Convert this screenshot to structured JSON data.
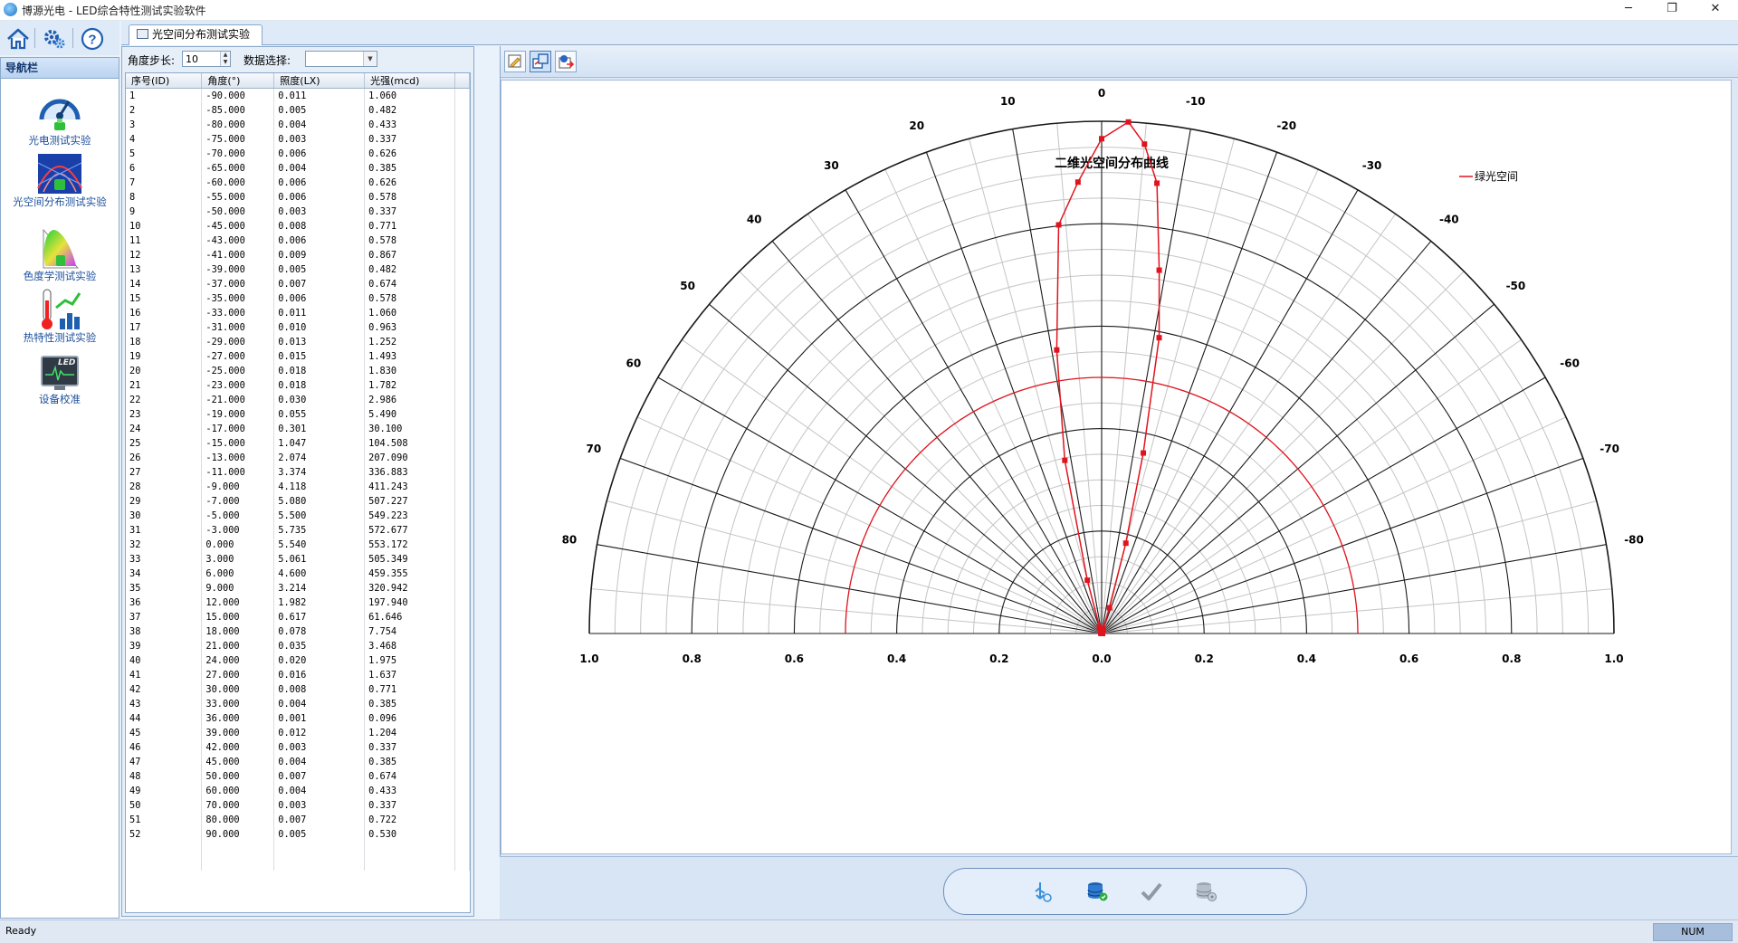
{
  "window": {
    "title": "博源光电 - LED综合特性测试实验软件",
    "minimize": "─",
    "restore": "❐",
    "close": "✕"
  },
  "toolbar": {
    "home_icon": "home-icon",
    "settings_icon": "gear-icon",
    "help_icon": "help-icon"
  },
  "nav": {
    "header": "导航栏",
    "items": [
      {
        "label": "光电测试实验",
        "icon": "gauge-icon"
      },
      {
        "label": "光空间分布测试实验",
        "icon": "spatial-distribution-icon"
      },
      {
        "label": "色度学测试实验",
        "icon": "chromaticity-icon"
      },
      {
        "label": "热特性测试实验",
        "icon": "thermometer-icon"
      },
      {
        "label": "设备校准",
        "icon": "calibration-monitor-icon"
      }
    ]
  },
  "tab": {
    "label": "光空间分布测试实验"
  },
  "controls": {
    "step_label": "角度步长:",
    "step_value": "10",
    "data_label": "数据选择:",
    "data_value": ""
  },
  "table": {
    "columns": [
      "序号(ID)",
      "角度(°)",
      "照度(LX)",
      "光强(mcd)"
    ],
    "rows": [
      [
        "1",
        "-90.000",
        "0.011",
        "1.060"
      ],
      [
        "2",
        "-85.000",
        "0.005",
        "0.482"
      ],
      [
        "3",
        "-80.000",
        "0.004",
        "0.433"
      ],
      [
        "4",
        "-75.000",
        "0.003",
        "0.337"
      ],
      [
        "5",
        "-70.000",
        "0.006",
        "0.626"
      ],
      [
        "6",
        "-65.000",
        "0.004",
        "0.385"
      ],
      [
        "7",
        "-60.000",
        "0.006",
        "0.626"
      ],
      [
        "8",
        "-55.000",
        "0.006",
        "0.578"
      ],
      [
        "9",
        "-50.000",
        "0.003",
        "0.337"
      ],
      [
        "10",
        "-45.000",
        "0.008",
        "0.771"
      ],
      [
        "11",
        "-43.000",
        "0.006",
        "0.578"
      ],
      [
        "12",
        "-41.000",
        "0.009",
        "0.867"
      ],
      [
        "13",
        "-39.000",
        "0.005",
        "0.482"
      ],
      [
        "14",
        "-37.000",
        "0.007",
        "0.674"
      ],
      [
        "15",
        "-35.000",
        "0.006",
        "0.578"
      ],
      [
        "16",
        "-33.000",
        "0.011",
        "1.060"
      ],
      [
        "17",
        "-31.000",
        "0.010",
        "0.963"
      ],
      [
        "18",
        "-29.000",
        "0.013",
        "1.252"
      ],
      [
        "19",
        "-27.000",
        "0.015",
        "1.493"
      ],
      [
        "20",
        "-25.000",
        "0.018",
        "1.830"
      ],
      [
        "21",
        "-23.000",
        "0.018",
        "1.782"
      ],
      [
        "22",
        "-21.000",
        "0.030",
        "2.986"
      ],
      [
        "23",
        "-19.000",
        "0.055",
        "5.490"
      ],
      [
        "24",
        "-17.000",
        "0.301",
        "30.100"
      ],
      [
        "25",
        "-15.000",
        "1.047",
        "104.508"
      ],
      [
        "26",
        "-13.000",
        "2.074",
        "207.090"
      ],
      [
        "27",
        "-11.000",
        "3.374",
        "336.883"
      ],
      [
        "28",
        "-9.000",
        "4.118",
        "411.243"
      ],
      [
        "29",
        "-7.000",
        "5.080",
        "507.227"
      ],
      [
        "30",
        "-5.000",
        "5.500",
        "549.223"
      ],
      [
        "31",
        "-3.000",
        "5.735",
        "572.677"
      ],
      [
        "32",
        "0.000",
        "5.540",
        "553.172"
      ],
      [
        "33",
        "3.000",
        "5.061",
        "505.349"
      ],
      [
        "34",
        "6.000",
        "4.600",
        "459.355"
      ],
      [
        "35",
        "9.000",
        "3.214",
        "320.942"
      ],
      [
        "36",
        "12.000",
        "1.982",
        "197.940"
      ],
      [
        "37",
        "15.000",
        "0.617",
        "61.646"
      ],
      [
        "38",
        "18.000",
        "0.078",
        "7.754"
      ],
      [
        "39",
        "21.000",
        "0.035",
        "3.468"
      ],
      [
        "40",
        "24.000",
        "0.020",
        "1.975"
      ],
      [
        "41",
        "27.000",
        "0.016",
        "1.637"
      ],
      [
        "42",
        "30.000",
        "0.008",
        "0.771"
      ],
      [
        "43",
        "33.000",
        "0.004",
        "0.385"
      ],
      [
        "44",
        "36.000",
        "0.001",
        "0.096"
      ],
      [
        "45",
        "39.000",
        "0.012",
        "1.204"
      ],
      [
        "46",
        "42.000",
        "0.003",
        "0.337"
      ],
      [
        "47",
        "45.000",
        "0.004",
        "0.385"
      ],
      [
        "48",
        "50.000",
        "0.007",
        "0.674"
      ],
      [
        "49",
        "60.000",
        "0.004",
        "0.433"
      ],
      [
        "50",
        "70.000",
        "0.003",
        "0.337"
      ],
      [
        "51",
        "80.000",
        "0.007",
        "0.722"
      ],
      [
        "52",
        "90.000",
        "0.005",
        "0.530"
      ]
    ]
  },
  "chart_toolbar": {
    "buttons": [
      "edit-chart-icon",
      "compare-chart-icon",
      "export-chart-icon"
    ]
  },
  "bottom_actions": [
    "usb-connect-icon",
    "database-save-icon",
    "confirm-check-icon",
    "database-settings-icon"
  ],
  "chart_data": {
    "type": "polar-semicircle",
    "title": "二维光空间分布曲线",
    "legend": [
      {
        "name": "绿光空间",
        "color": "#e0141e",
        "position": "top-right"
      }
    ],
    "angle_range": [
      -90,
      90
    ],
    "angle_labels": [
      0,
      10,
      20,
      30,
      40,
      50,
      60,
      70,
      80,
      -10,
      -20,
      -30,
      -40,
      -50,
      -60,
      -70,
      -80
    ],
    "radius_range": [
      0,
      1
    ],
    "radius_ticks": [
      "1.0",
      "0.8",
      "0.6",
      "0.4",
      "0.2",
      "0.0",
      "0.2",
      "0.4",
      "0.6",
      "0.8",
      "1.0"
    ],
    "reference_circle": 0.5,
    "series": [
      {
        "name": "绿光空间",
        "color": "#e0141e",
        "angle": [
          -90,
          -85,
          -80,
          -75,
          -70,
          -65,
          -60,
          -55,
          -50,
          -45,
          -43,
          -41,
          -39,
          -37,
          -35,
          -33,
          -31,
          -29,
          -27,
          -25,
          -23,
          -21,
          -19,
          -17,
          -15,
          -13,
          -11,
          -9,
          -7,
          -5,
          -3,
          0,
          3,
          6,
          9,
          12,
          15,
          18,
          21,
          24,
          27,
          30,
          33,
          36,
          39,
          42,
          45,
          50,
          60,
          70,
          80,
          90
        ],
        "value": [
          1.06,
          0.482,
          0.433,
          0.337,
          0.626,
          0.385,
          0.626,
          0.578,
          0.337,
          0.771,
          0.578,
          0.867,
          0.482,
          0.674,
          0.578,
          1.06,
          0.963,
          1.252,
          1.493,
          1.83,
          1.782,
          2.986,
          5.49,
          30.1,
          104.508,
          207.09,
          336.883,
          411.243,
          507.227,
          549.223,
          572.677,
          553.172,
          505.349,
          459.355,
          320.942,
          197.94,
          61.646,
          7.754,
          3.468,
          1.975,
          1.637,
          0.771,
          0.385,
          0.096,
          1.204,
          0.337,
          0.385,
          0.674,
          0.433,
          0.337,
          0.722,
          0.53
        ]
      }
    ]
  },
  "status": {
    "text": "Ready",
    "num": "NUM"
  }
}
